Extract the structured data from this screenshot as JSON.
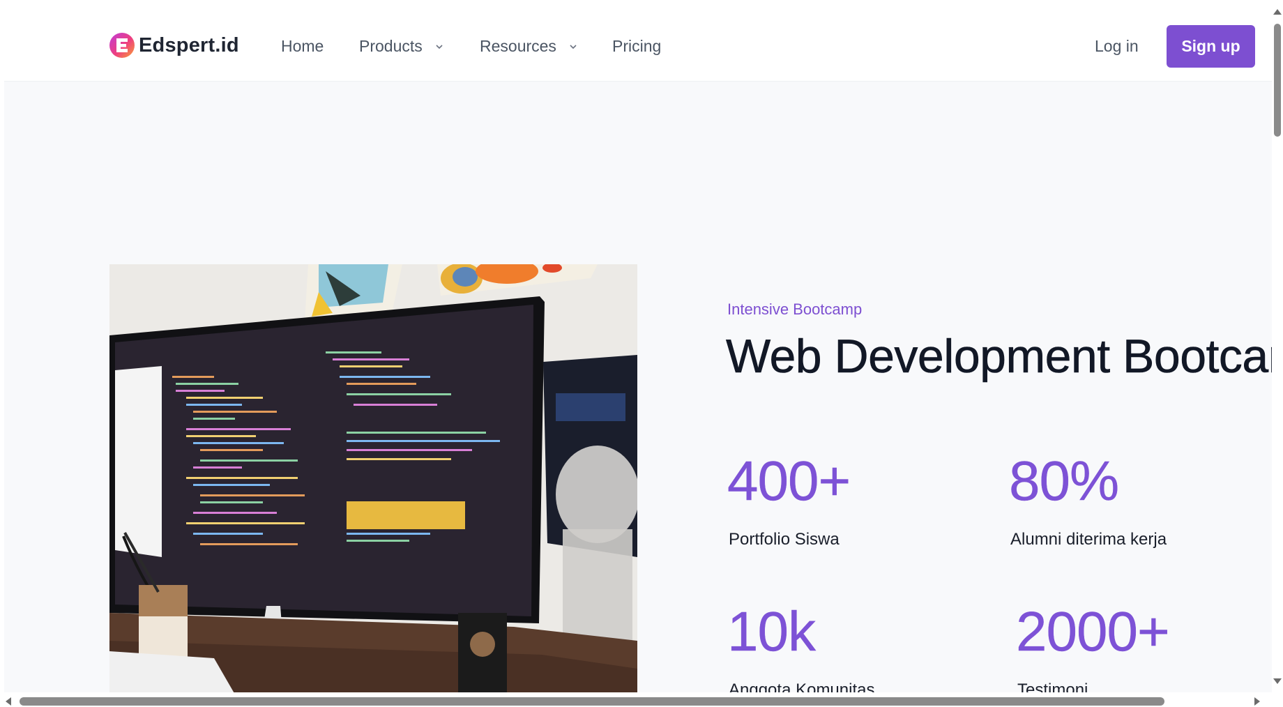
{
  "brand": {
    "name": "Edspert.id",
    "logo_letter": "E"
  },
  "nav": {
    "home": "Home",
    "products": "Products",
    "resources": "Resources",
    "pricing": "Pricing",
    "login": "Log in",
    "signup": "Sign up"
  },
  "hero": {
    "eyebrow": "Intensive Bootcamp",
    "title": "Web Development Bootcamp",
    "stats": [
      {
        "value": "400+",
        "label": "Portfolio Siswa"
      },
      {
        "value": "80%",
        "label": "Alumni diterima kerja"
      },
      {
        "value": "10k",
        "label": "Anggota Komunitas"
      },
      {
        "value": "2000+",
        "label": "Testimoni"
      }
    ]
  },
  "colors": {
    "accent": "#7d4fd1",
    "text_dark": "#121826",
    "nav_text": "#4b5563",
    "page_bg": "#f8f9fb"
  },
  "icons": [
    "chevron-down-icon",
    "logo-icon"
  ]
}
